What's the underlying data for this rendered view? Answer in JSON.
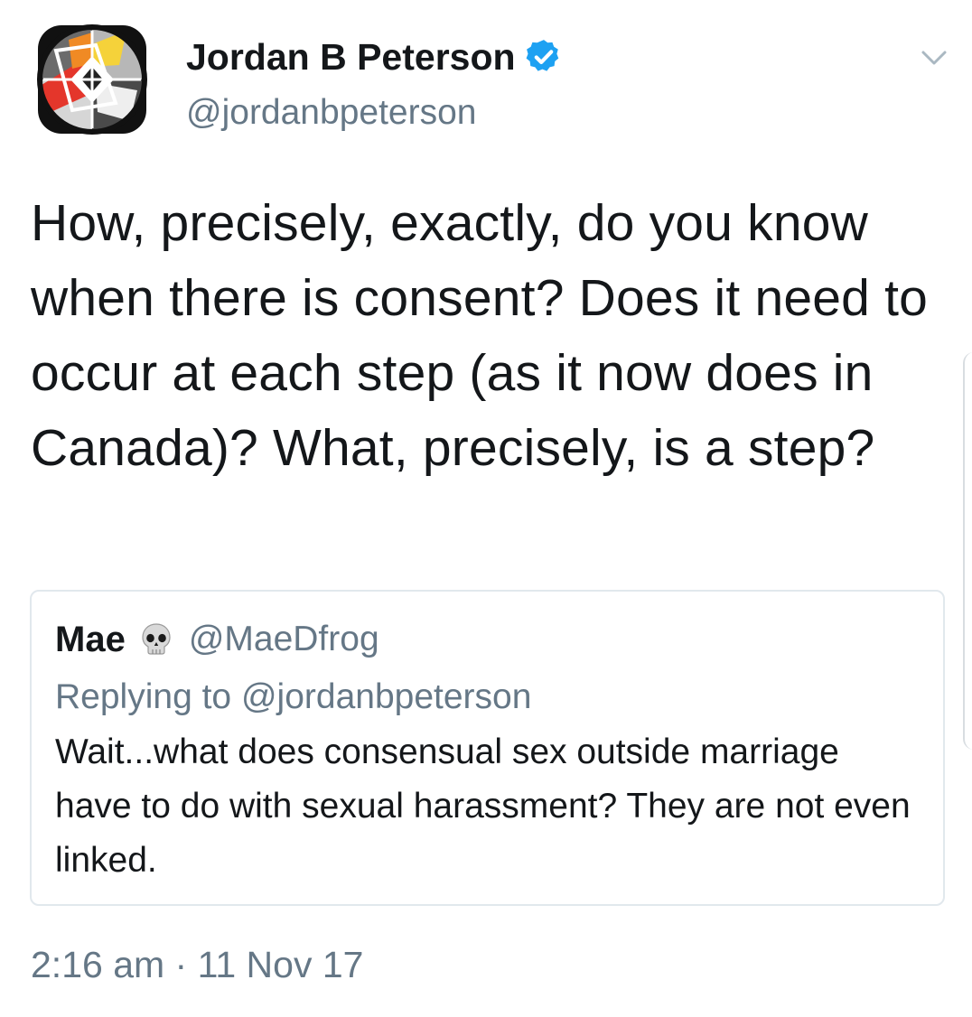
{
  "author": {
    "name": "Jordan B Peterson",
    "handle": "@jordanbpeterson",
    "avatar_icon": "abstract-logo-avatar",
    "verified_icon": "verified-badge-icon"
  },
  "menu_icon": "chevron-down-icon",
  "tweet": {
    "text": "How, precisely, exactly, do you know when there is consent? Does it need to occur at each step (as it now does in Canada)? What, precisely, is a step?"
  },
  "quoted_tweet": {
    "name": "Mae",
    "emoji_icon": "skull-icon",
    "handle": "@MaeDfrog",
    "replying_prefix": "Replying to ",
    "replying_to": "@jordanbpeterson",
    "text": "Wait...what does consensual sex outside marriage have to do with sexual harassment? They are not even linked."
  },
  "timestamp": {
    "time": "2:16 am",
    "separator": " · ",
    "date": "11 Nov 17"
  },
  "colors": {
    "text_primary": "#14171a",
    "text_secondary": "#657786",
    "verified_blue": "#1da1f2",
    "card_border": "#e1e8ed"
  }
}
